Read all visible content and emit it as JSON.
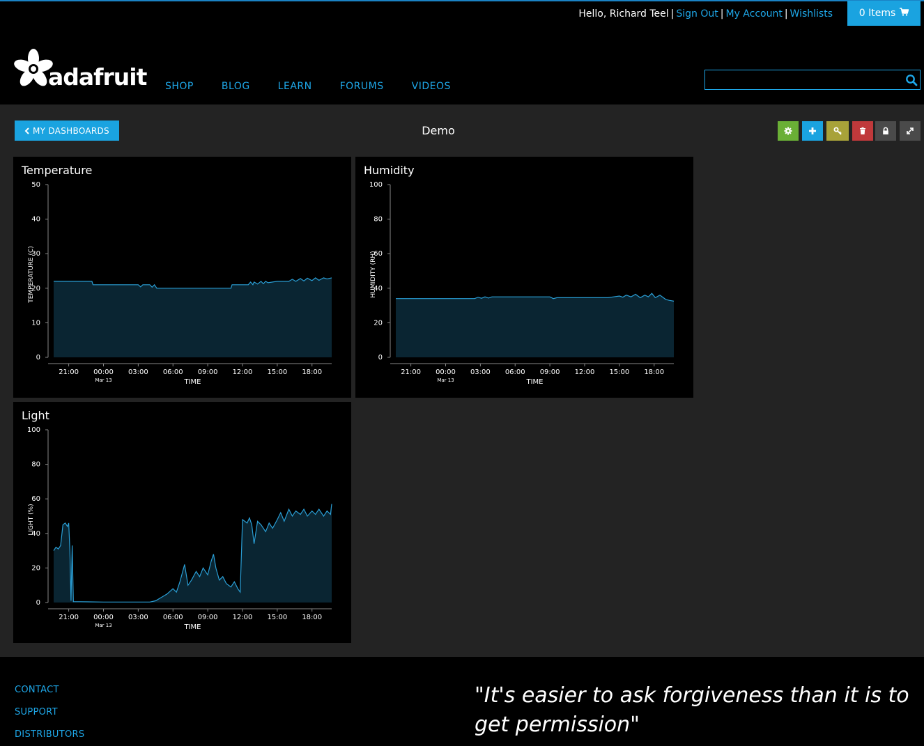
{
  "userbar": {
    "greeting": "Hello, Richard Teel",
    "sign_out": "Sign Out",
    "my_account": "My Account",
    "wishlists": "Wishlists",
    "cart_label": "0 Items"
  },
  "header": {
    "logo_text": "adafruit",
    "nav": [
      "SHOP",
      "BLOG",
      "LEARN",
      "FORUMS",
      "VIDEOS"
    ],
    "search": {
      "value": "",
      "placeholder": ""
    }
  },
  "dashboard": {
    "back_label": "MY DASHBOARDS",
    "title": "Demo",
    "tools": [
      {
        "name": "settings",
        "icon": "gear-icon",
        "color": "#6aaf36"
      },
      {
        "name": "add-block",
        "icon": "plus-icon",
        "color": "#1aa3e0"
      },
      {
        "name": "keys",
        "icon": "key-icon",
        "color": "#a8a239"
      },
      {
        "name": "delete",
        "icon": "trash-icon",
        "color": "#c0393b"
      },
      {
        "name": "lock",
        "icon": "lock-icon",
        "color": "#4a4a4a"
      },
      {
        "name": "fullscreen",
        "icon": "expand-icon",
        "color": "#4a4a4a"
      }
    ]
  },
  "colors": {
    "accent": "#1aa3e0",
    "chart_line": "#2a9fd6",
    "chart_fill": "#0a2532",
    "panel_bg": "#000000",
    "page_bg": "#232323"
  },
  "chart_data": [
    {
      "type": "area",
      "title": "Temperature",
      "ylabel": "TEMPERATURE (C)",
      "xlabel": "TIME",
      "ylim": [
        0,
        50
      ],
      "yticks": [
        0,
        10,
        20,
        30,
        40,
        50
      ],
      "xticks": [
        "21:00",
        "00:00",
        "03:00",
        "06:00",
        "09:00",
        "12:00",
        "15:00",
        "18:00"
      ],
      "xtick_sublabel": "Mar 13",
      "xrange": [
        19.7,
        43.7
      ],
      "x": [
        19.7,
        23.0,
        23.1,
        27.0,
        27.2,
        27.4,
        28.0,
        28.2,
        28.4,
        28.6,
        29.0,
        31.0,
        35.0,
        35.1,
        36.5,
        36.7,
        36.9,
        37.0,
        37.3,
        37.6,
        37.8,
        38.0,
        38.2,
        39.0,
        40.0,
        40.3,
        40.6,
        41.0,
        41.3,
        41.6,
        42.0,
        42.3,
        42.6,
        43.0,
        43.3,
        43.7
      ],
      "y": [
        22,
        22,
        21,
        21,
        20.4,
        21,
        21,
        20.3,
        21,
        20,
        20,
        20,
        20,
        21,
        21,
        21.8,
        21,
        21.8,
        21.2,
        22,
        21.3,
        22,
        21.6,
        22,
        22,
        22.6,
        22,
        22.8,
        22.1,
        22.9,
        22.2,
        23,
        22.3,
        23,
        22.7,
        23
      ]
    },
    {
      "type": "area",
      "title": "Humidity",
      "ylabel": "HUMIDITY (RH)",
      "xlabel": "TIME",
      "ylim": [
        0,
        100
      ],
      "yticks": [
        0,
        20,
        40,
        60,
        80,
        100
      ],
      "xticks": [
        "21:00",
        "00:00",
        "03:00",
        "06:00",
        "09:00",
        "12:00",
        "15:00",
        "18:00"
      ],
      "xtick_sublabel": "Mar 13",
      "xrange": [
        19.7,
        43.7
      ],
      "x": [
        19.7,
        26.5,
        26.8,
        27.1,
        27.4,
        27.7,
        28.0,
        28.3,
        33.0,
        33.3,
        33.6,
        38.0,
        38.5,
        39.0,
        39.3,
        39.6,
        40.0,
        40.4,
        40.8,
        41.2,
        41.5,
        41.8,
        42.1,
        42.5,
        43.0,
        43.3,
        43.7
      ],
      "y": [
        34,
        34,
        34.8,
        34.2,
        35,
        34.3,
        35,
        35,
        35,
        34,
        34.5,
        34.5,
        35,
        35.5,
        34.8,
        36,
        35,
        36.5,
        34.5,
        36,
        35,
        37,
        34.5,
        36,
        33.5,
        33,
        32.5
      ]
    },
    {
      "type": "area",
      "title": "Light",
      "ylabel": "LIGHT (%)",
      "xlabel": "TIME",
      "ylim": [
        0,
        100
      ],
      "yticks": [
        0,
        20,
        40,
        60,
        80,
        100
      ],
      "xticks": [
        "21:00",
        "00:00",
        "03:00",
        "06:00",
        "09:00",
        "12:00",
        "15:00",
        "18:00"
      ],
      "xtick_sublabel": "Mar 13",
      "xrange": [
        19.7,
        43.7
      ],
      "x": [
        19.7,
        19.9,
        20.1,
        20.3,
        20.5,
        20.7,
        20.9,
        21.0,
        21.1,
        21.2,
        21.3,
        21.4,
        21.5,
        22.0,
        24.0,
        28.0,
        28.5,
        29.0,
        29.5,
        30.0,
        30.3,
        30.6,
        31.0,
        31.3,
        31.6,
        32.0,
        32.3,
        32.6,
        33.0,
        33.3,
        33.5,
        33.7,
        34.0,
        34.3,
        34.6,
        35.0,
        35.3,
        35.6,
        35.8,
        36.0,
        36.2,
        36.4,
        36.6,
        36.8,
        37.0,
        37.3,
        37.6,
        38.0,
        38.3,
        38.6,
        39.0,
        39.3,
        39.6,
        40.0,
        40.3,
        40.6,
        41.0,
        41.3,
        41.6,
        42.0,
        42.3,
        42.6,
        43.0,
        43.3,
        43.6,
        43.7
      ],
      "y": [
        30,
        32,
        31,
        33,
        45,
        46,
        44,
        46,
        30,
        1,
        33,
        0.5,
        0.5,
        0.5,
        0.3,
        0.3,
        1,
        3,
        5,
        8,
        6,
        12,
        22,
        10,
        13,
        18,
        15,
        20,
        16,
        24,
        28,
        20,
        13,
        15,
        11,
        9,
        12,
        8,
        6,
        48,
        47,
        46,
        49,
        45,
        34,
        47,
        45,
        41,
        46,
        43,
        48,
        52,
        47,
        54,
        50,
        53,
        51,
        54,
        50,
        53,
        51,
        54,
        50,
        53,
        51,
        57
      ]
    }
  ],
  "footer": {
    "links": [
      "CONTACT",
      "SUPPORT",
      "DISTRIBUTORS"
    ],
    "quote": "\"It's easier to ask forgiveness than it is to get permission\""
  }
}
